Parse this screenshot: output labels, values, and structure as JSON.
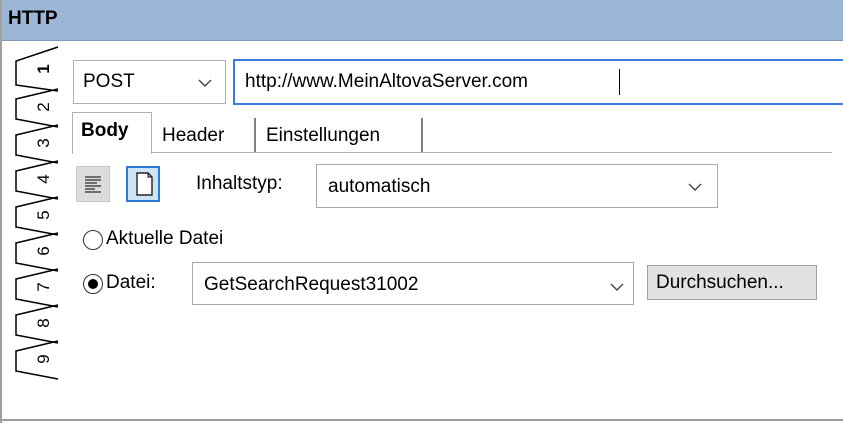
{
  "window": {
    "title": "HTTP"
  },
  "vertical_tabs": [
    {
      "label": "1",
      "active": true
    },
    {
      "label": "2",
      "active": false
    },
    {
      "label": "3",
      "active": false
    },
    {
      "label": "4",
      "active": false
    },
    {
      "label": "5",
      "active": false
    },
    {
      "label": "6",
      "active": false
    },
    {
      "label": "7",
      "active": false
    },
    {
      "label": "8",
      "active": false
    },
    {
      "label": "9",
      "active": false
    }
  ],
  "request": {
    "method": "POST",
    "url": "http://www.MeinAltovaServer.com"
  },
  "tabs": [
    {
      "label": "Body",
      "active": true
    },
    {
      "label": "Header",
      "active": false
    },
    {
      "label": "Einstellungen",
      "active": false
    }
  ],
  "body": {
    "content_type_label": "Inhaltstyp:",
    "content_type_value": "automatisch",
    "option_current_file": "Aktuelle Datei",
    "option_file": "Datei:",
    "selected_option": "file",
    "file_value": "GetSearchRequest31002",
    "browse_label": "Durchsuchen..."
  },
  "icons": {
    "text_view": "text-lines-icon",
    "file_view": "document-icon",
    "dropdown": "chevron-down-icon"
  },
  "colors": {
    "titlebar": "#9cb7d6",
    "focus": "#3b7ae0",
    "selected_button": "#cde4f7"
  }
}
